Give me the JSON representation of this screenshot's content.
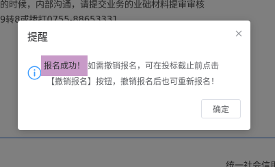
{
  "background": {
    "top_line": "的时候，内部沟通，请提交业务的业础材料提审审核",
    "line2": "9转8或拨打0755-88653331",
    "bottom_text": "统一社会信用"
  },
  "dialog": {
    "title": "提醒",
    "message_highlight": "报名成功！",
    "message_rest_1": "如需撤销报名，可在投标截止前点击",
    "message_rest_2": "【撤销报名】按钮，撤销报名后也可重新报名！",
    "confirm_label": "确定",
    "close_icon": "close-icon",
    "info_icon": "info-icon"
  },
  "colors": {
    "overlay": "#7f7f7f",
    "highlight": "#c89ac8",
    "info_icon": "#409eff",
    "rule": "#2f6fd1"
  }
}
